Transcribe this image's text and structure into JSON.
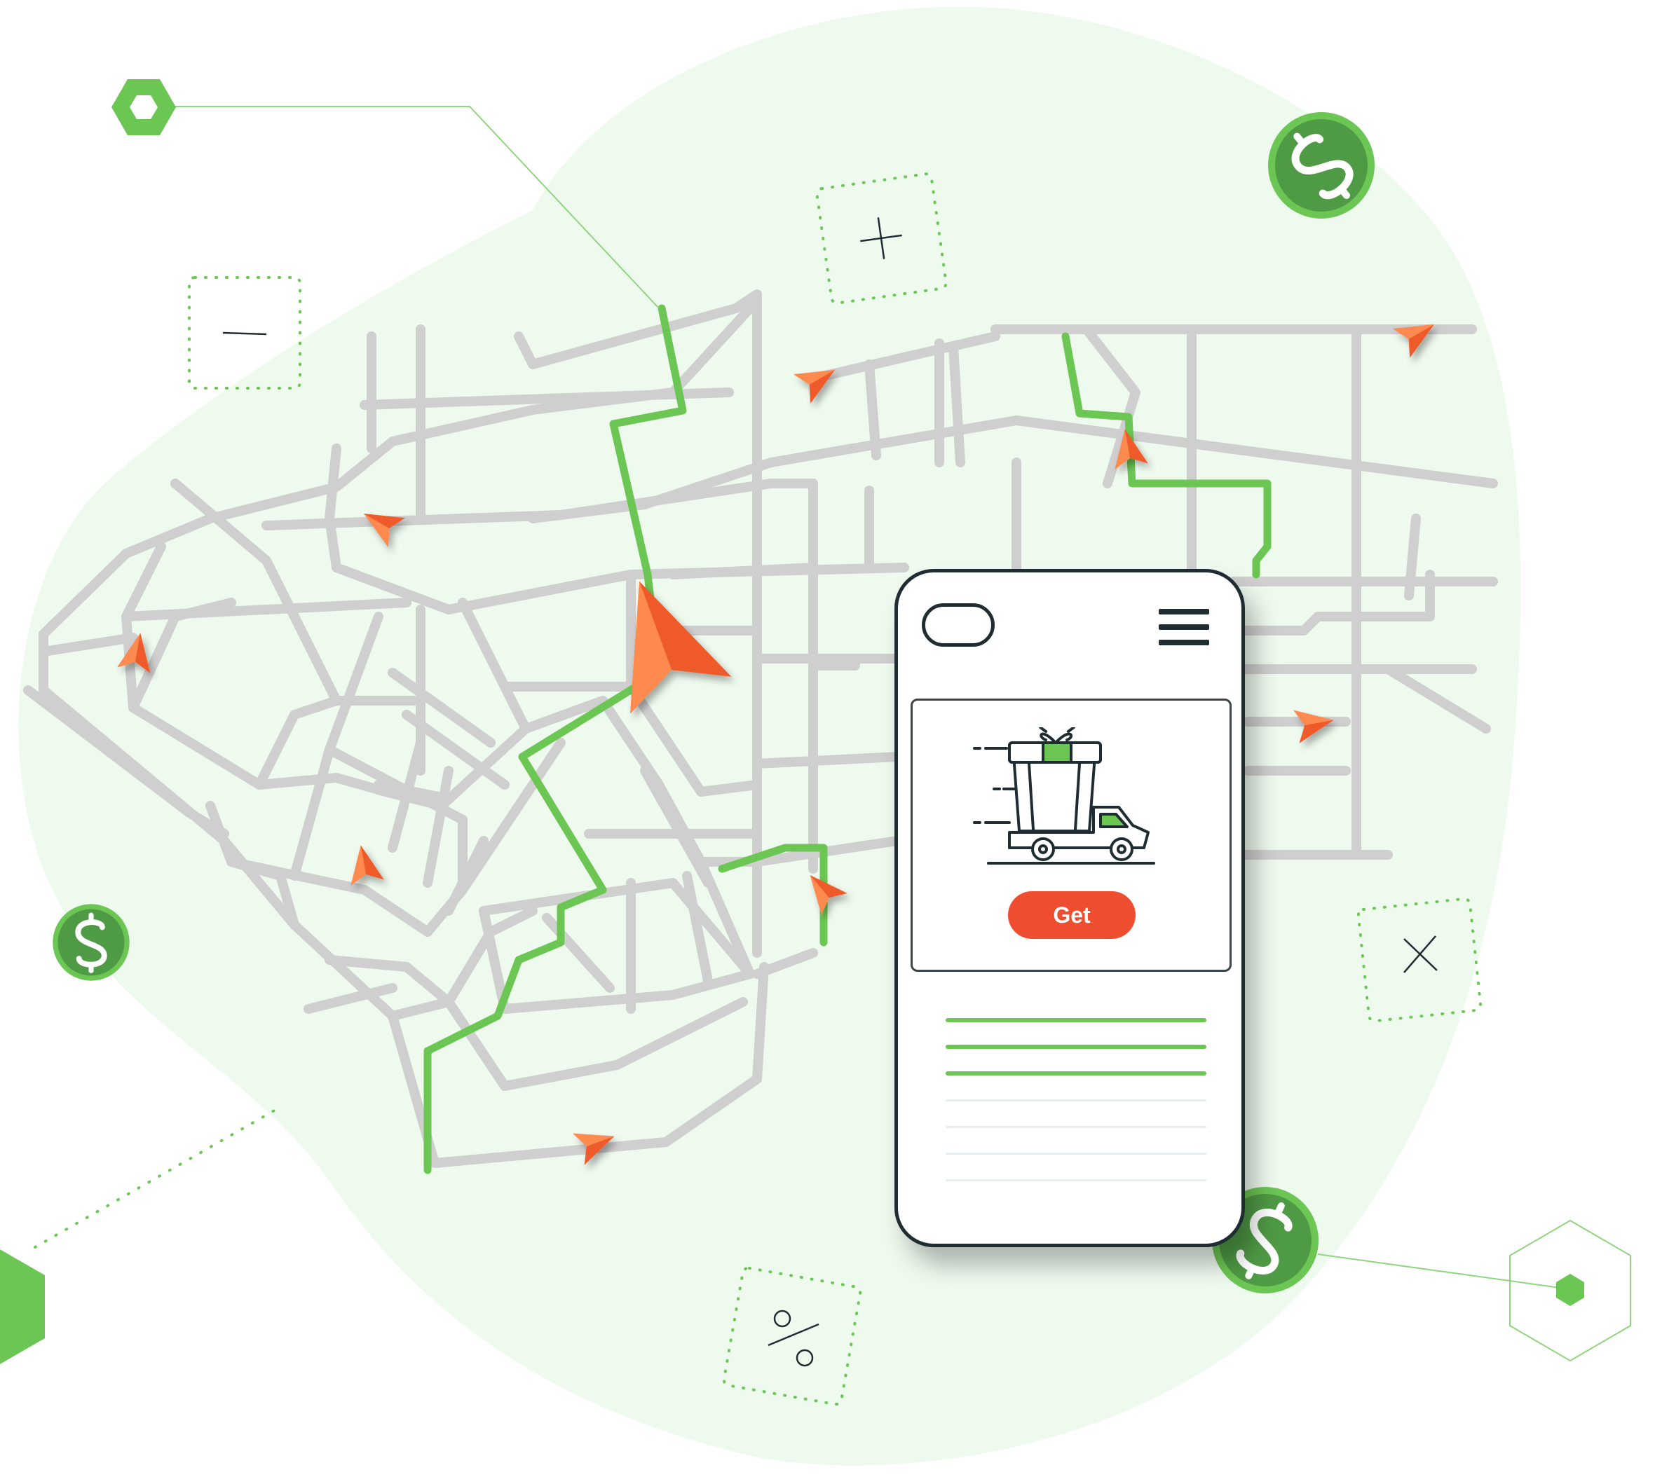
{
  "colors": {
    "blob": "#effaef",
    "road": "#cfcfcf",
    "route": "#6cc654",
    "arrow": "#ef5a2a",
    "coin": "#4f9a45",
    "coin_ring": "#6cc654",
    "ink": "#1f2d33"
  },
  "icons": {
    "coins": [
      "dollar-coin-icon",
      "dollar-coin-icon",
      "dollar-coin-icon"
    ],
    "zoom_in": "plus-icon",
    "zoom_out": "minus-icon",
    "close": "close-icon",
    "discount": "percent-icon",
    "menu": "hamburger-menu-icon",
    "delivery": "delivery-truck-gift-icon"
  },
  "phone": {
    "button_label": "Get",
    "content_lines": 3,
    "placeholder_lines": 4
  }
}
